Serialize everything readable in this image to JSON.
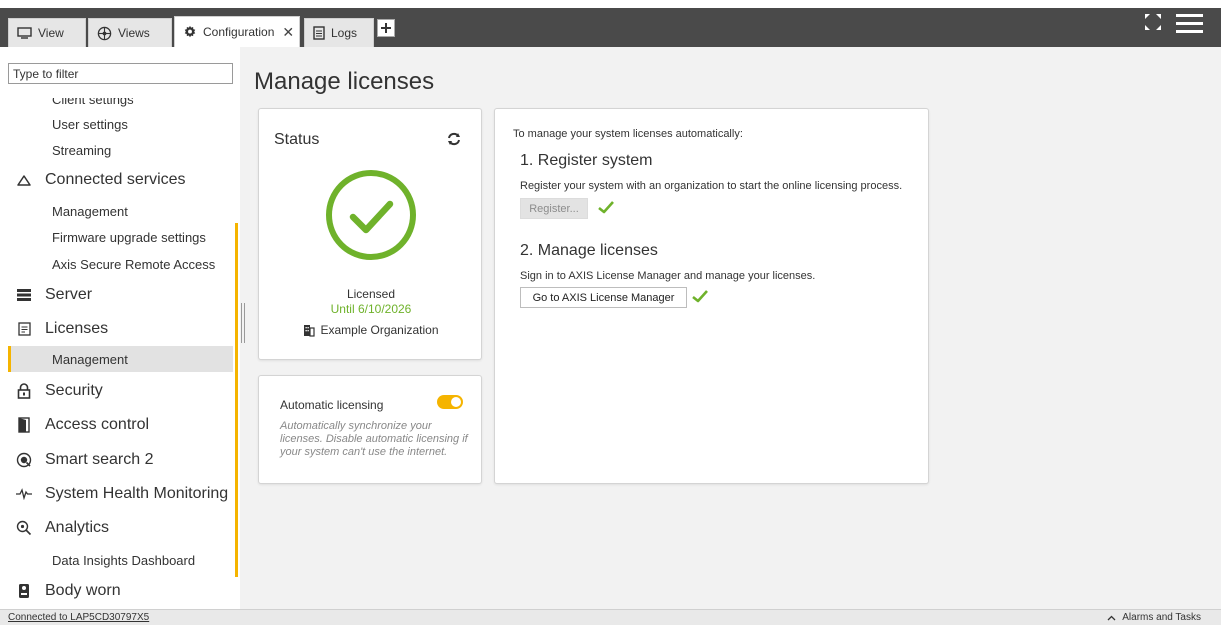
{
  "tabs": [
    {
      "label": "View",
      "icon": "monitor-icon",
      "active": false
    },
    {
      "label": "Views",
      "icon": "views-icon",
      "active": false
    },
    {
      "label": "Configuration",
      "icon": "gear-icon",
      "active": true
    },
    {
      "label": "Logs",
      "icon": "document-icon",
      "active": false
    }
  ],
  "sidebar": {
    "filter_placeholder": "Type to filter",
    "items": [
      {
        "label": "Client settings",
        "level": "sub"
      },
      {
        "label": "User settings",
        "level": "sub"
      },
      {
        "label": "Streaming",
        "level": "sub"
      },
      {
        "label": "Connected services",
        "level": "top",
        "icon": "cloud-icon"
      },
      {
        "label": "Management",
        "level": "sub"
      },
      {
        "label": "Firmware upgrade settings",
        "level": "sub"
      },
      {
        "label": "Axis Secure Remote Access",
        "level": "sub"
      },
      {
        "label": "Server",
        "level": "top",
        "icon": "server-icon"
      },
      {
        "label": "Licenses",
        "level": "top",
        "icon": "license-icon"
      },
      {
        "label": "Management",
        "level": "sub",
        "selected": true
      },
      {
        "label": "Security",
        "level": "top",
        "icon": "lock-icon"
      },
      {
        "label": "Access control",
        "level": "top",
        "icon": "door-icon"
      },
      {
        "label": "Smart search 2",
        "level": "top",
        "icon": "smart-search-icon"
      },
      {
        "label": "System Health Monitoring",
        "level": "top",
        "icon": "pulse-icon"
      },
      {
        "label": "Analytics",
        "level": "top",
        "icon": "analytics-icon"
      },
      {
        "label": "Data Insights Dashboard",
        "level": "sub"
      },
      {
        "label": "Body worn",
        "level": "top",
        "icon": "body-worn-icon"
      }
    ]
  },
  "main": {
    "title": "Manage licenses",
    "status_card": {
      "title": "Status",
      "state": "Licensed",
      "until": "Until 6/10/2026",
      "organization": "Example Organization"
    },
    "auto_card": {
      "label": "Automatic licensing",
      "enabled": true,
      "description": "Automatically synchronize your licenses. Disable automatic licensing if your system can't use the internet."
    },
    "manage_card": {
      "intro": "To manage your system licenses automatically:",
      "step1_title": "1. Register system",
      "step1_text": "Register your system with an organization to start the online licensing process.",
      "step1_button": "Register...",
      "step2_title": "2. Manage licenses",
      "step2_text": "Sign in to AXIS License Manager and manage your licenses.",
      "step2_button": "Go to AXIS License Manager"
    }
  },
  "statusbar": {
    "connection": "Connected to LAP5CD30797X5",
    "alarms": "Alarms and Tasks"
  },
  "colors": {
    "accent": "#f5b400",
    "success": "#6fb22b",
    "topbar": "#4a4a4a"
  }
}
